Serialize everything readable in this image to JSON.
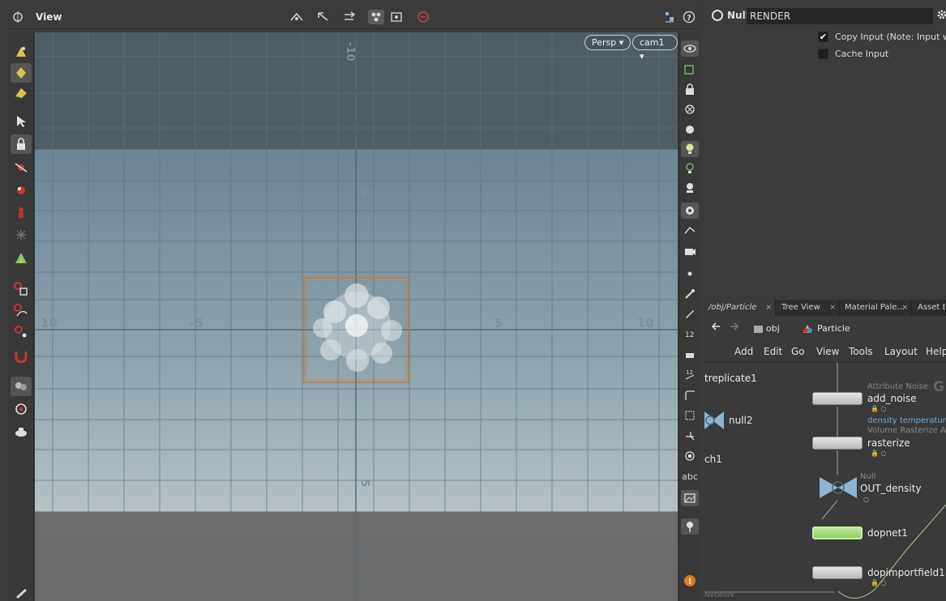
{
  "viewer": {
    "title": "View",
    "camera_menu": "Persp",
    "camera_name": "cam1",
    "axis_labels": {
      "h_neg10": "10",
      "h_neg5": "-5",
      "h_5": "5",
      "h_10": "10",
      "v_top10": "-10",
      "v_neg5": "-5",
      "v_5": "5"
    },
    "icons": {
      "top_toolbar": [
        "view-icon",
        "handle-icon",
        "select-icon",
        "snap-icon",
        "ghost-icon",
        "vis-icon",
        "no-entry-icon",
        "camera-menu-icon",
        "help-icon"
      ],
      "left_toolbar": [
        "select-tool-icon",
        "lock-icon",
        "move-icon",
        "rotate-icon",
        "scale-icon",
        "pose-icon",
        "snap-icon",
        "magnet-icon",
        "render-icon"
      ],
      "right_toolbar": [
        "eye-icon",
        "wire-icon",
        "lock-icon",
        "x-ray-icon",
        "light-icon",
        "bulb-icon",
        "geo-icon",
        "camera-icon",
        "abc-icon",
        "pin-icon",
        "warning-icon"
      ]
    },
    "right_toolbar_text": "abc",
    "warning_badge": "!"
  },
  "params": {
    "node_type": "Null",
    "node_name": "RENDER",
    "copy_input_label": "Copy Input (Note: Input will",
    "copy_input_checked": true,
    "cache_input_label": "Cache Input",
    "cache_input_checked": false
  },
  "network": {
    "tabs": [
      {
        "label": "/obj/Particle",
        "active": true
      },
      {
        "label": "Tree View",
        "active": false
      },
      {
        "label": "Material Pale...",
        "active": false
      },
      {
        "label": "Asset Br",
        "active": false
      }
    ],
    "path": {
      "root": "obj",
      "current": "Particle"
    },
    "menu": [
      "Add",
      "Edit",
      "Go",
      "View",
      "Tools",
      "Layout",
      "Help"
    ],
    "footer_label": "Network",
    "nodes": [
      {
        "name": "treplicate1",
        "type": ""
      },
      {
        "name": "null2",
        "type": ""
      },
      {
        "name": "ch1",
        "type": ""
      },
      {
        "name": "add_noise",
        "type": "Attribute Noise"
      },
      {
        "name": "rasterize",
        "type": "Volume Rasterize At",
        "note": "density temperatur"
      },
      {
        "name": "OUT_density",
        "type": "Null"
      },
      {
        "name": "dopnet1",
        "type": ""
      },
      {
        "name": "dopimportfield1",
        "type": ""
      }
    ],
    "node_letter": "G"
  },
  "colors": {
    "bound_box": "#c07a3a",
    "dop_node": "#9fd97a",
    "note_link": "#5aa3e0"
  }
}
